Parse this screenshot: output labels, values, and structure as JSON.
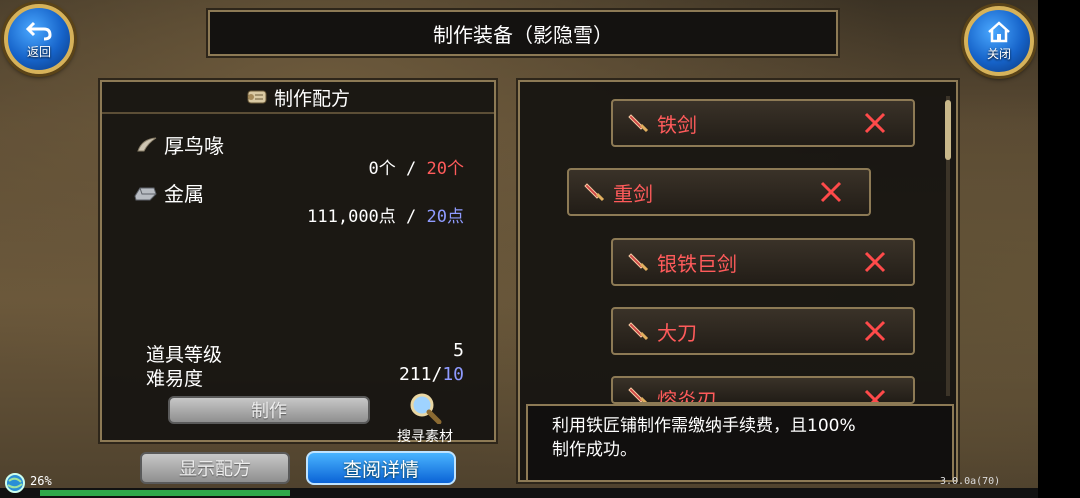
{
  "header": {
    "back_label": "返回",
    "close_label": "关闭",
    "title": "制作装备（影隐雪）"
  },
  "recipe": {
    "header": "制作配方",
    "materials": [
      {
        "name": "厚鸟喙",
        "have": "0个",
        "sep": " / ",
        "need": "20个"
      },
      {
        "name": "金属",
        "have": "111,000点",
        "sep": " / ",
        "need": "20点"
      }
    ],
    "item_level_label": "道具等级",
    "item_level_value": "5",
    "difficulty_label": "难易度",
    "difficulty_have": "211/",
    "difficulty_max": "10",
    "craft_label": "制作",
    "search_label": "搜寻素材"
  },
  "bottom_buttons": {
    "show_recipe": "显示配方",
    "view_details": "查阅详情"
  },
  "weapon_list": [
    {
      "name": "铁剑"
    },
    {
      "name": "重剑"
    },
    {
      "name": "银铁巨剑"
    },
    {
      "name": "大刀"
    },
    {
      "name": "熔炎刃"
    }
  ],
  "tooltip": {
    "line1": "利用铁匠铺制作需缴纳手续费，且100%",
    "line2": "制作成功。"
  },
  "status": {
    "exp_percent": "26%",
    "version": "3.0.0a(70)"
  },
  "colors": {
    "required_red": "#ff5b5b",
    "required_blue": "#8f9bff",
    "accent_gold": "#8d7a55"
  }
}
